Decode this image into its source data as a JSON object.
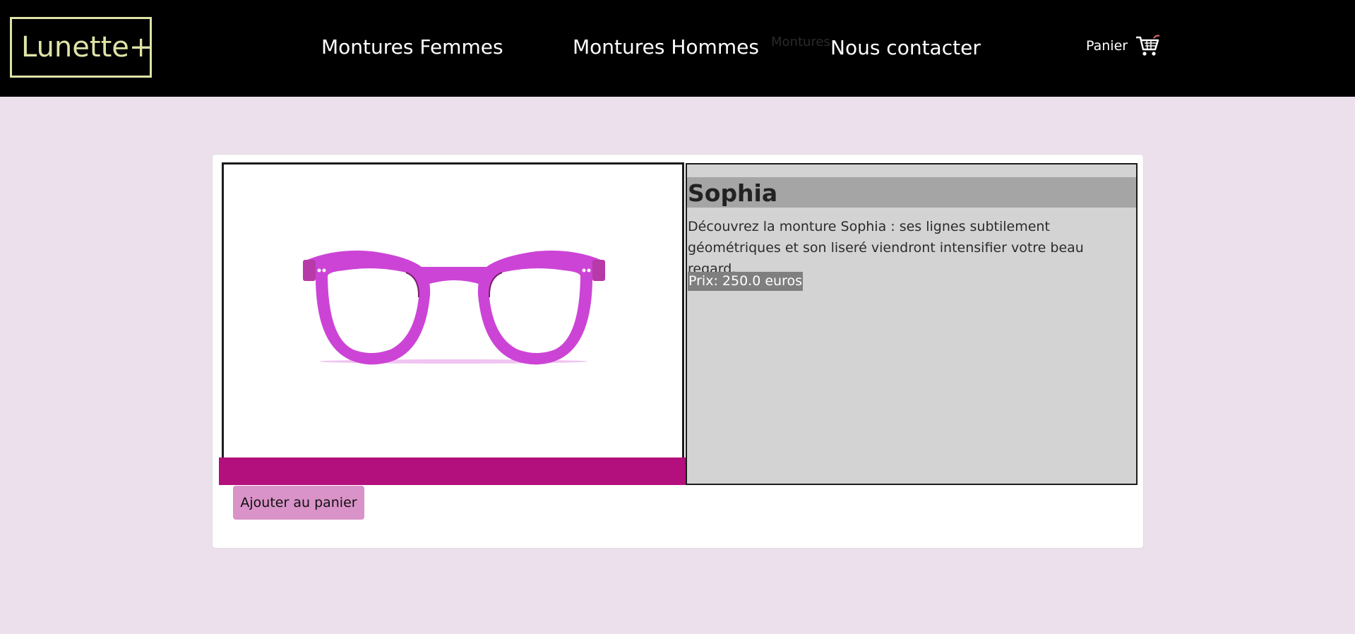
{
  "header": {
    "logo": "Lunette+",
    "nav": {
      "femmes": "Montures Femmes",
      "hommes": "Montures Hommes",
      "ghost": "Montures",
      "contact": "Nous contacter"
    },
    "cart_label": "Panier",
    "cart_icon": "cart-icon"
  },
  "product": {
    "name": "Sophia",
    "description": "Découvrez la monture Sophia : ses lignes subtilement géométriques et son liseré viendront intensifier votre beau regard.",
    "price": "Prix: 250.0 euros",
    "add_to_cart": "Ajouter au panier",
    "image_icon": "glasses-image"
  },
  "colors": {
    "header_bg": "#000000",
    "page_bg": "#ede0ed",
    "logo": "#dfe3a6",
    "accent_bar": "#b30f7d",
    "button": "#d993c8",
    "frame": "#cc44d6"
  }
}
